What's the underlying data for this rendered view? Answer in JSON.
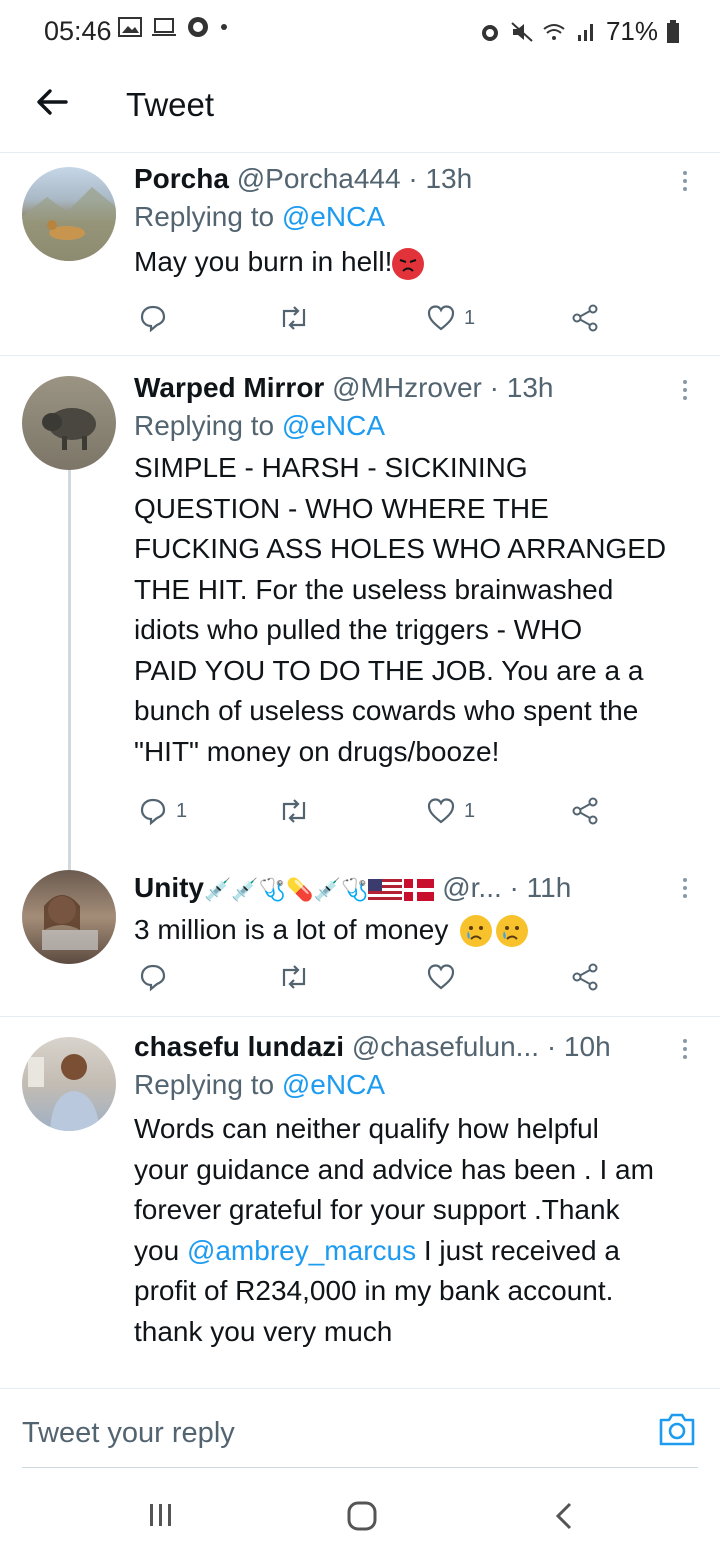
{
  "status_bar": {
    "time": "05:46",
    "battery": "71%"
  },
  "header": {
    "title": "Tweet"
  },
  "tweets": [
    {
      "name": "Porcha",
      "handle": "@Porcha444",
      "time": "13h",
      "replying_prefix": "Replying to",
      "replying_to": "@eNCA",
      "text": "May you burn in hell!",
      "reply_count": "",
      "like_count": "1"
    },
    {
      "name": "Warped Mirror",
      "handle": "@MHzrover",
      "time": "13h",
      "replying_prefix": "Replying to",
      "replying_to": "@eNCA",
      "text_lines": [
        "SIMPLE - HARSH - SICKINING",
        "QUESTION - WHO WHERE THE",
        "FUCKING ASS HOLES WHO ARRANGED",
        "THE HIT. For the useless brainwashed",
        "idiots who pulled the triggers - WHO",
        "PAID YOU TO DO THE JOB. You are a a",
        "bunch of useless cowards who spent the",
        "\"HIT\" money on drugs/booze!"
      ],
      "reply_count": "1",
      "like_count": "1"
    },
    {
      "name": "Unity",
      "handle": "@r...",
      "time": "11h",
      "text": "3 million is a lot of money",
      "reply_count": "",
      "like_count": ""
    },
    {
      "name": "chasefu lundazi",
      "handle": "@chasefulun...",
      "time": "10h",
      "replying_prefix": "Replying to",
      "replying_to": "@eNCA",
      "text_line1": "Words can neither qualify how helpful",
      "text_line2": "your guidance and advice has been . I am",
      "text_line3": "forever grateful for your support .Thank",
      "text_line4_prefix": "you",
      "text_line4_mention": "@ambrey_marcus",
      "text_line4_suffix": "I just received a",
      "text_line5": "profit of R234,000 in my bank account.",
      "text_line6": "thank you very much"
    }
  ],
  "reply_bar": {
    "placeholder": "Tweet your reply"
  },
  "colors": {
    "link": "#1d9bf0",
    "secondary": "#536471"
  }
}
